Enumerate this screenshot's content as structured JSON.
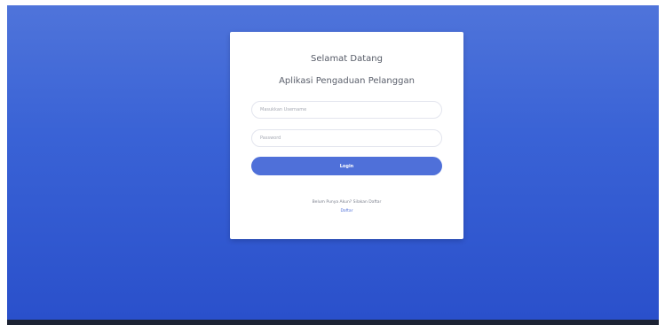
{
  "login": {
    "welcome": "Selamat Datang",
    "app_title": "Aplikasi Pengaduan Pelanggan",
    "username_placeholder": "Masukkan Username",
    "password_placeholder": "Password",
    "login_button": "Login",
    "register_prompt": "Belum Punya Akun? Silakan Daftar",
    "register_link": "Daftar"
  },
  "colors": {
    "background_top": "#4f74da",
    "background_bottom": "#2a50cb",
    "accent": "#4f70d9",
    "card": "#ffffff"
  }
}
